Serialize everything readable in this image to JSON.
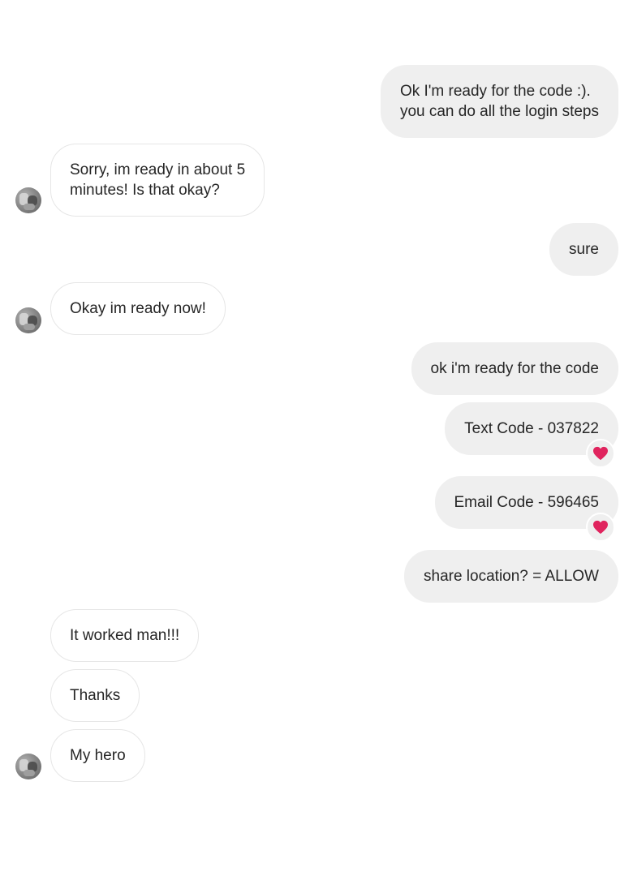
{
  "conversation": {
    "messages": [
      {
        "sender": "me",
        "lines": [
          "Ok I'm ready for the code :).",
          "you can do all the login steps"
        ]
      },
      {
        "sender": "them",
        "lines": [
          "Sorry, im ready in about 5",
          "minutes! Is that okay?"
        ]
      },
      {
        "sender": "me",
        "lines": [
          "sure"
        ]
      },
      {
        "sender": "them",
        "lines": [
          "Okay im ready now!"
        ]
      },
      {
        "sender": "me",
        "lines": [
          "ok i'm ready for the code"
        ]
      },
      {
        "sender": "me",
        "lines": [
          "Text Code - 037822"
        ],
        "reaction": "heart-icon"
      },
      {
        "sender": "me",
        "lines": [
          "Email Code - 596465"
        ],
        "reaction": "heart-icon"
      },
      {
        "sender": "me",
        "lines": [
          "share location? = ALLOW"
        ]
      },
      {
        "sender": "them",
        "lines": [
          "It worked man!!!"
        ]
      },
      {
        "sender": "them",
        "lines": [
          "Thanks"
        ]
      },
      {
        "sender": "them",
        "lines": [
          "My hero"
        ]
      }
    ]
  },
  "colors": {
    "sent_bubble": "#efefef",
    "received_bubble": "#ffffff",
    "received_border": "#e6e6e6",
    "text": "#262626",
    "heart": "#e0245e"
  },
  "icons": {
    "reaction": "heart-icon",
    "avatar": "contact-avatar"
  }
}
